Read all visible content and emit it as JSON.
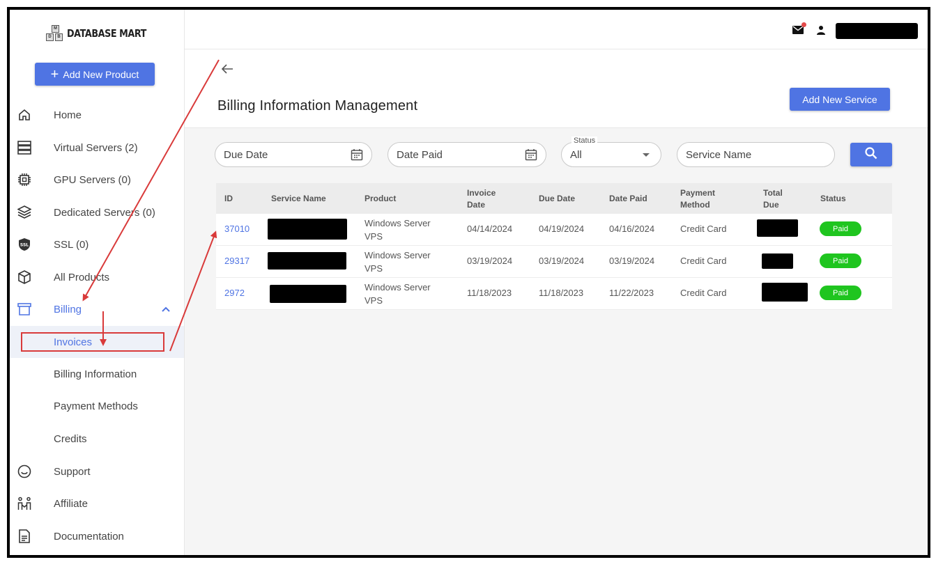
{
  "brand": {
    "name": "DATABASE MART",
    "logo_letters": [
      "M",
      "D",
      "B"
    ]
  },
  "sidebar": {
    "add_button": "Add New Product",
    "items": [
      {
        "label": "Home",
        "icon": "home-icon"
      },
      {
        "label": "Virtual Servers (2)",
        "icon": "server-icon"
      },
      {
        "label": "GPU Servers (0)",
        "icon": "chip-icon"
      },
      {
        "label": "Dedicated Servers (0)",
        "icon": "cube-stack-icon"
      },
      {
        "label": "SSL (0)",
        "icon": "ssl-shield-icon"
      },
      {
        "label": "All Products",
        "icon": "box-icon"
      },
      {
        "label": "Billing",
        "icon": "billing-icon"
      }
    ],
    "billing_sub": [
      "Invoices",
      "Billing Information",
      "Payment Methods",
      "Credits"
    ],
    "bottom_items": [
      {
        "label": "Support",
        "icon": "smile-icon"
      },
      {
        "label": "Affiliate",
        "icon": "affiliate-icon"
      },
      {
        "label": "Documentation",
        "icon": "document-icon"
      }
    ]
  },
  "page": {
    "title": "Billing Information Management",
    "add_service": "Add New Service"
  },
  "filters": {
    "due_date": "Due Date",
    "date_paid": "Date Paid",
    "status_label": "Status",
    "status_value": "All",
    "service_name": "Service Name"
  },
  "table": {
    "headers": {
      "id": "ID",
      "service": "Service Name",
      "product": "Product",
      "invoice_date_1": "Invoice",
      "invoice_date_2": "Date",
      "due_date": "Due Date",
      "date_paid": "Date Paid",
      "payment_1": "Payment",
      "payment_2": "Method",
      "total_1": "Total",
      "total_2": "Due",
      "status": "Status"
    },
    "rows": [
      {
        "id": "37010",
        "product_1": "Windows Server",
        "product_2": "VPS",
        "invoice_date": "04/14/2024",
        "due_date": "04/19/2024",
        "date_paid": "04/16/2024",
        "payment": "Credit Card",
        "status": "Paid"
      },
      {
        "id": "29317",
        "product_1": "Windows Server",
        "product_2": "VPS",
        "invoice_date": "03/19/2024",
        "due_date": "03/19/2024",
        "date_paid": "03/19/2024",
        "payment": "Credit Card",
        "status": "Paid"
      },
      {
        "id": "2972",
        "product_1": "Windows Server",
        "product_2": "VPS",
        "invoice_date": "11/18/2023",
        "due_date": "11/18/2023",
        "date_paid": "11/22/2023",
        "payment": "Credit Card",
        "status": "Paid"
      }
    ]
  },
  "colors": {
    "accent": "#4f74e3",
    "paid": "#1fc51f",
    "annotation": "#d93a3a"
  }
}
